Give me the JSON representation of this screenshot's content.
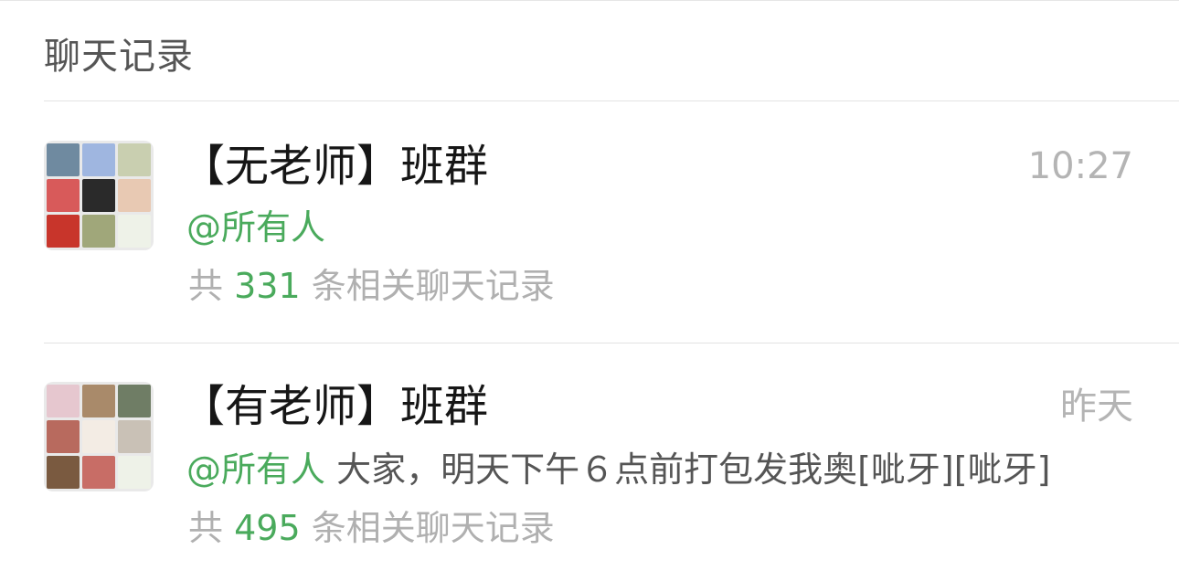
{
  "section": {
    "header": "聊天记录"
  },
  "results": [
    {
      "title": "【无老师】班群",
      "time": "10:27",
      "mention": "@所有人",
      "message": "",
      "count_prefix": "共",
      "count": "331",
      "count_suffix": "条相关聊天记录",
      "avatar_tiles": [
        "#6f8aa0",
        "#9fb6e0",
        "#c9cfb0",
        "#d85a5a",
        "#2a2a2a",
        "#e8c9b3",
        "#c8352b",
        "#a0a77a",
        "#eef2e8"
      ]
    },
    {
      "title": "【有老师】班群",
      "time": "昨天",
      "mention": "@所有人",
      "message": "大家，明天下午６点前打包发我奥[呲牙][呲牙]",
      "count_prefix": "共",
      "count": "495",
      "count_suffix": "条相关聊天记录",
      "avatar_tiles": [
        "#e6c7cf",
        "#a98a6a",
        "#6f7d65",
        "#b86a5e",
        "#f3ece4",
        "#c9c1b6",
        "#7a5a40",
        "#c86d66",
        "#eef2e8"
      ]
    }
  ],
  "colors": {
    "accent_green": "#4aaa5c",
    "secondary_gray": "#b0b0b0",
    "title_black": "#161616"
  }
}
